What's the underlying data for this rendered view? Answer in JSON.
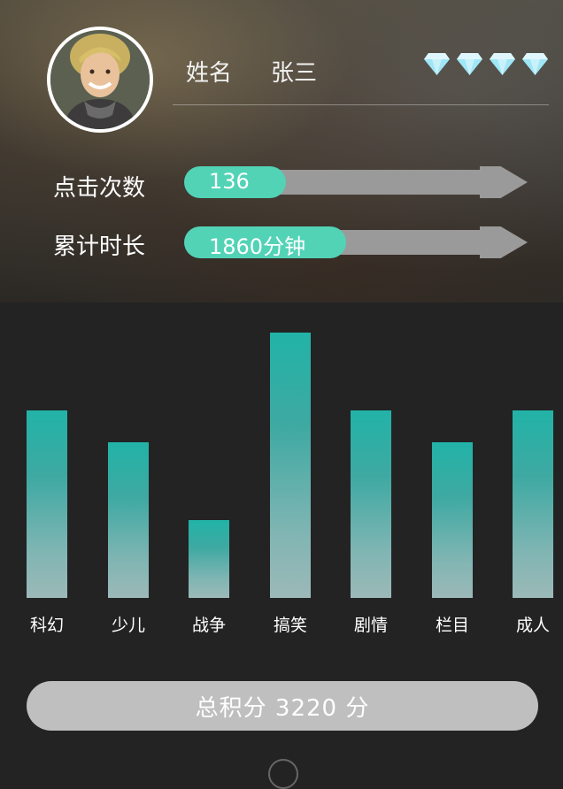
{
  "profile": {
    "name_label": "姓名",
    "name_value": "张三",
    "diamond_count": 4,
    "diamond_color": "#9fe6f6"
  },
  "stats": [
    {
      "label": "点击次数",
      "value_text": "136",
      "fill_fraction": 0.27
    },
    {
      "label": "累计时长",
      "value_text": "1860分钟",
      "fill_fraction": 0.5
    }
  ],
  "colors": {
    "accent": "#52d3b6",
    "track": "#9a9a9a",
    "bar_top": "#22b3a7",
    "bar_bottom": "#9cb9b8",
    "panel": "#232323"
  },
  "chart_data": {
    "type": "bar",
    "categories": [
      "科幻",
      "少儿",
      "战争",
      "搞笑",
      "剧情",
      "栏目",
      "成人"
    ],
    "values": [
      6,
      5,
      2.5,
      8.5,
      6,
      5,
      6
    ],
    "ylim": [
      0,
      8.5
    ]
  },
  "total": {
    "text": "总积分 3220 分"
  }
}
